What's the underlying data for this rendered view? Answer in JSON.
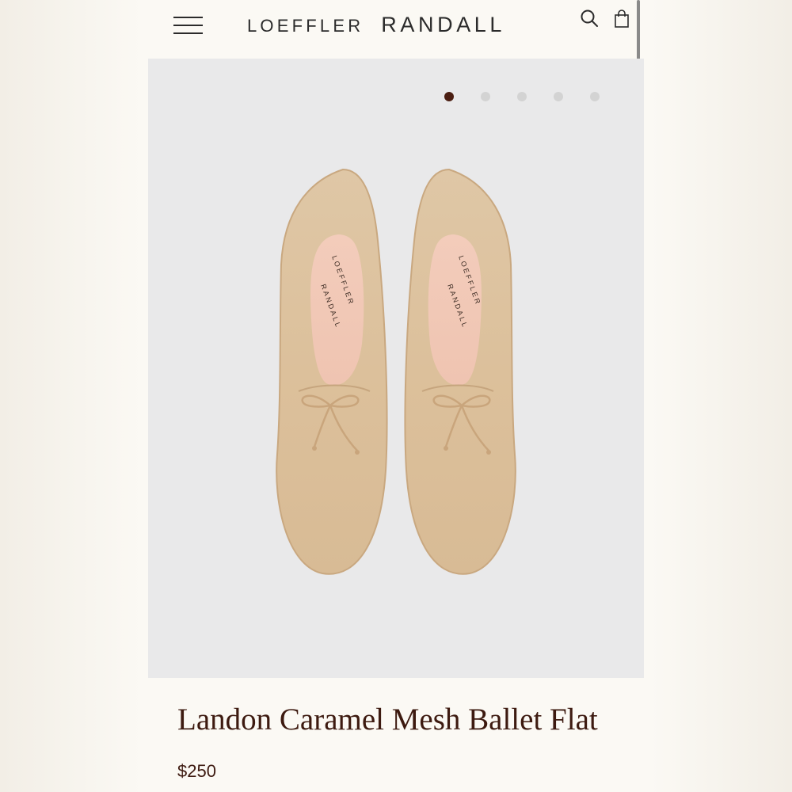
{
  "header": {
    "brand_first": "LOEFFLER",
    "brand_second": "RANDALL"
  },
  "icons": {
    "menu": "hamburger-menu-icon",
    "search": "search-icon",
    "cart": "shopping-bag-icon"
  },
  "carousel": {
    "slide_count": 5,
    "active_slide": 1
  },
  "product_image": {
    "insole_brand_first": "LOEFFLER",
    "insole_brand_second": "RANDALL"
  },
  "product": {
    "title": "Landon Caramel Mesh Ballet Flat",
    "price": "$250"
  },
  "colors": {
    "accent": "#4b1e12",
    "text": "#3d1a10",
    "hero_bg": "#e9e9ea",
    "shoe": "#dcc19c",
    "insole": "#f1c9b8"
  }
}
